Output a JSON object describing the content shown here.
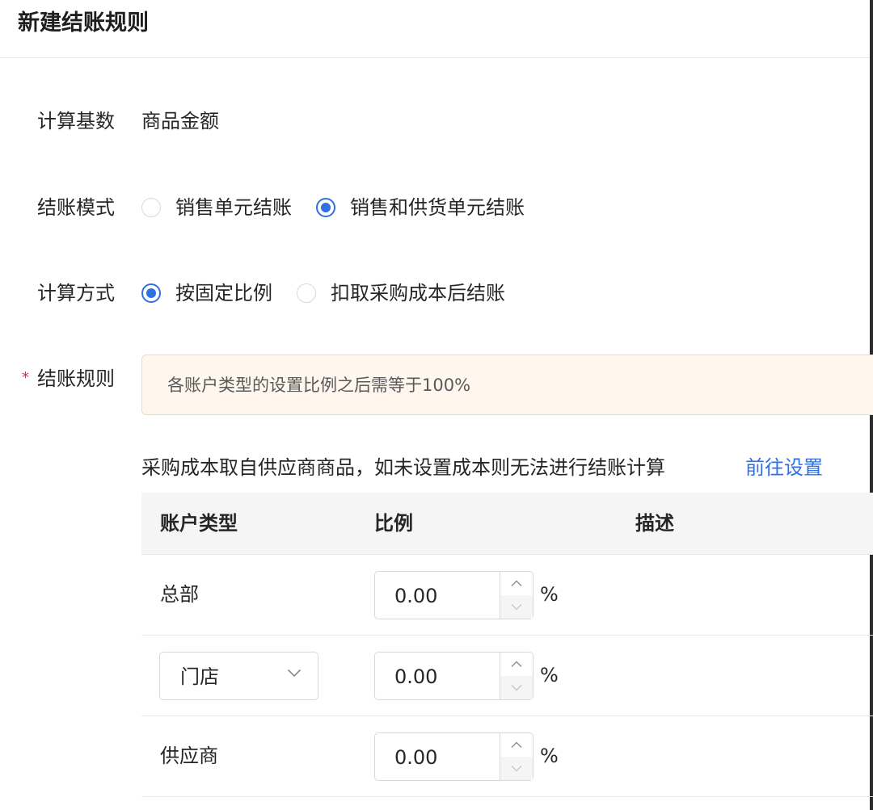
{
  "header": {
    "title": "新建结账规则"
  },
  "form": {
    "base": {
      "label": "计算基数",
      "value": "商品金额"
    },
    "mode": {
      "label": "结账模式",
      "options": [
        {
          "label": "销售单元结账",
          "checked": false
        },
        {
          "label": "销售和供货单元结账",
          "checked": true
        }
      ]
    },
    "method": {
      "label": "计算方式",
      "options": [
        {
          "label": "按固定比例",
          "checked": true
        },
        {
          "label": "扣取采购成本后结账",
          "checked": false
        }
      ]
    },
    "rules": {
      "required_mark": "*",
      "label": "结账规则",
      "alert": "各账户类型的设置比例之后需等于100%",
      "note": "采购成本取自供应商商品，如未设置成本则无法进行结账计算",
      "link": "前往设置"
    }
  },
  "table": {
    "columns": [
      "账户类型",
      "比例",
      "描述"
    ],
    "rows": [
      {
        "type": "总部",
        "ratio": "0.00",
        "unit": "%",
        "editable_type": false
      },
      {
        "type": "门店",
        "ratio": "0.00",
        "unit": "%",
        "editable_type": true
      },
      {
        "type": "供应商",
        "ratio": "0.00",
        "unit": "%",
        "editable_type": false
      }
    ]
  },
  "colors": {
    "primary": "#2f6fe4",
    "required": "#f5222d",
    "alert_bg": "#fff7ee",
    "alert_border": "#f8d8b4"
  },
  "icons": [
    "radio-icon",
    "chevron-down-icon",
    "chevron-up-icon"
  ]
}
